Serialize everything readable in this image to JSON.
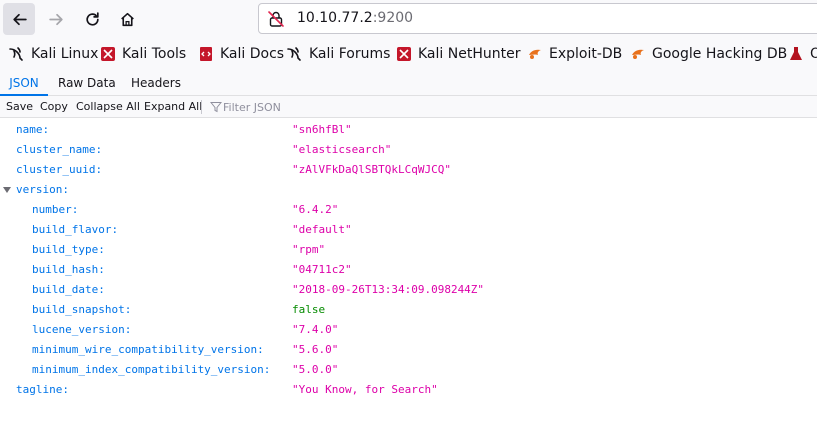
{
  "browser": {
    "url_host": "10.10.77.2",
    "url_port": ":9200"
  },
  "bookmarks": [
    {
      "label": "Kali Linux",
      "icon": "kali-dragon-icon"
    },
    {
      "label": "Kali Tools",
      "icon": "kali-tools-icon"
    },
    {
      "label": "Kali Docs",
      "icon": "kali-docs-icon"
    },
    {
      "label": "Kali Forums",
      "icon": "kali-dragon-icon"
    },
    {
      "label": "Kali NetHunter",
      "icon": "kali-nethunter-icon"
    },
    {
      "label": "Exploit-DB",
      "icon": "exploit-db-icon"
    },
    {
      "label": "Google Hacking DB",
      "icon": "exploit-db-icon"
    },
    {
      "label": "O",
      "icon": "offsec-icon"
    }
  ],
  "viewer_tabs": [
    {
      "label": "JSON",
      "active": true
    },
    {
      "label": "Raw Data",
      "active": false
    },
    {
      "label": "Headers",
      "active": false
    }
  ],
  "toolbar": {
    "save": "Save",
    "copy": "Copy",
    "collapse_all": "Collapse All",
    "expand_all": "Expand All",
    "filter_placeholder": "Filter JSON"
  },
  "json": {
    "name": {
      "key": "name:",
      "value": "\"sn6hfBl\""
    },
    "cluster_name": {
      "key": "cluster_name:",
      "value": "\"elasticsearch\""
    },
    "cluster_uuid": {
      "key": "cluster_uuid:",
      "value": "\"zAlVFkDaQlSBTQkLCqWJCQ\""
    },
    "version_key": "version:",
    "version": [
      {
        "key": "number:",
        "value": "\"6.4.2\"",
        "type": "string"
      },
      {
        "key": "build_flavor:",
        "value": "\"default\"",
        "type": "string"
      },
      {
        "key": "build_type:",
        "value": "\"rpm\"",
        "type": "string"
      },
      {
        "key": "build_hash:",
        "value": "\"04711c2\"",
        "type": "string"
      },
      {
        "key": "build_date:",
        "value": "\"2018-09-26T13:34:09.098244Z\"",
        "type": "string"
      },
      {
        "key": "build_snapshot:",
        "value": "false",
        "type": "boolean"
      },
      {
        "key": "lucene_version:",
        "value": "\"7.4.0\"",
        "type": "string"
      },
      {
        "key": "minimum_wire_compatibility_version:",
        "value": "\"5.6.0\"",
        "type": "string"
      },
      {
        "key": "minimum_index_compatibility_version:",
        "value": "\"5.0.0\"",
        "type": "string"
      }
    ],
    "tagline": {
      "key": "tagline:",
      "value": "\"You Know, for Search\""
    }
  },
  "colors": {
    "key": "#0074e8",
    "string": "#dd00a9",
    "boolean": "#058b00",
    "accent": "#0074e8"
  }
}
